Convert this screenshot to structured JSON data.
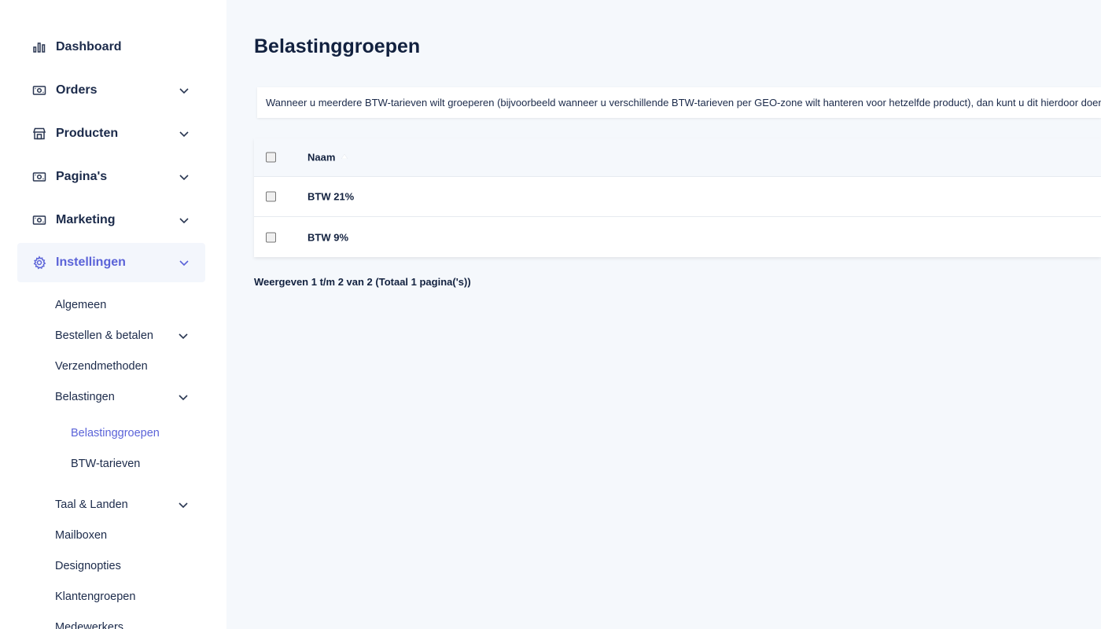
{
  "sidebar": {
    "items": [
      {
        "label": "Dashboard",
        "icon": "bar-chart-icon"
      },
      {
        "label": "Orders",
        "icon": "cash-icon"
      },
      {
        "label": "Producten",
        "icon": "store-icon"
      },
      {
        "label": "Pagina's",
        "icon": "cash-icon"
      },
      {
        "label": "Marketing",
        "icon": "cash-icon"
      },
      {
        "label": "Instellingen",
        "icon": "gear-icon"
      }
    ],
    "settings_sub": [
      {
        "label": "Algemeen"
      },
      {
        "label": "Bestellen & betalen"
      },
      {
        "label": "Verzendmethoden"
      },
      {
        "label": "Belastingen"
      },
      {
        "label": "Taal & Landen"
      },
      {
        "label": "Mailboxen"
      },
      {
        "label": "Designopties"
      },
      {
        "label": "Klantengroepen"
      },
      {
        "label": "Medewerkers"
      }
    ],
    "tax_sub": [
      {
        "label": "Belastinggroepen"
      },
      {
        "label": "BTW-tarieven"
      }
    ]
  },
  "main": {
    "title": "Belastinggroepen",
    "info": "Wanneer u meerdere BTW-tarieven wilt groeperen (bijvoorbeeld wanneer u verschillende BTW-tarieven per GEO-zone wilt hanteren voor hetzelfde product), dan kunt u dit hierdoor doen.",
    "table": {
      "header_name": "Naam",
      "rows": [
        {
          "name": "BTW 21%"
        },
        {
          "name": "BTW 9%"
        }
      ]
    },
    "pagination_info": "Weergeven 1 t/m 2 van 2 (Totaal 1 pagina('s))"
  },
  "colors": {
    "accent": "#5b63d8",
    "text": "#1b2a4a",
    "background": "#f5f8fc"
  }
}
